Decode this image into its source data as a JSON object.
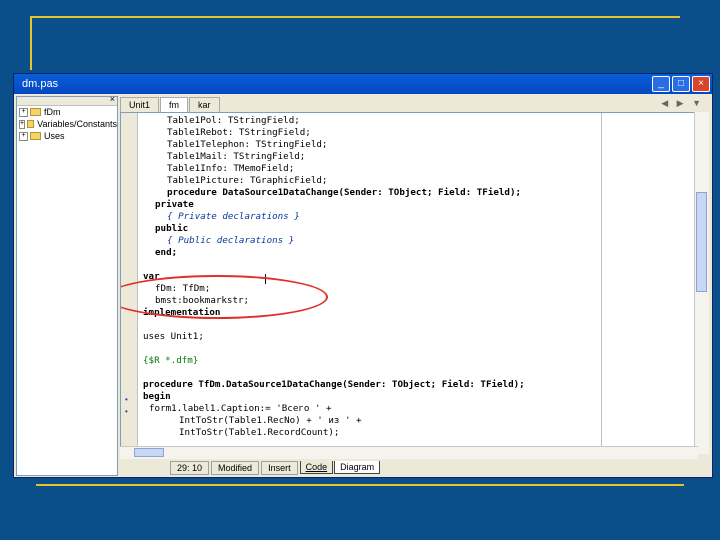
{
  "window": {
    "title": "dm.pas"
  },
  "tree": {
    "items": [
      {
        "label": "fDm"
      },
      {
        "label": "Variables/Constants"
      },
      {
        "label": "Uses"
      }
    ]
  },
  "tabs": [
    {
      "label": "Unit1"
    },
    {
      "label": "fm"
    },
    {
      "label": "kar"
    }
  ],
  "code": {
    "lines": [
      "Table1Pol: TStringField;",
      "Table1Rebot: TStringField;",
      "Table1Telephon: TStringField;",
      "Table1Mail: TStringField;",
      "Table1Info: TMemoField;",
      "Table1Picture: TGraphicField;",
      "procedure DataSource1DataChange(Sender: TObject; Field: TField);",
      "private",
      "{ Private declarations }",
      "public",
      "{ Public declarations }",
      "end;",
      "",
      "var",
      "fDm: TfDm;",
      "bmst:bookmarkstr;",
      "implementation",
      "",
      "uses Unit1;",
      "",
      "{$R *.dfm}",
      "",
      "procedure TfDm.DataSource1DataChange(Sender: TObject; Field: TField);",
      "begin",
      "form1.label1.Caption:= 'Всего ' +",
      "IntToStr(Table1.RecNo) + ' из ' +",
      "IntToStr(Table1.RecordCount);"
    ]
  },
  "status": {
    "position": "29: 10",
    "modified": "Modified",
    "mode": "Insert",
    "bottom_tabs": [
      "Code",
      "Diagram"
    ]
  }
}
